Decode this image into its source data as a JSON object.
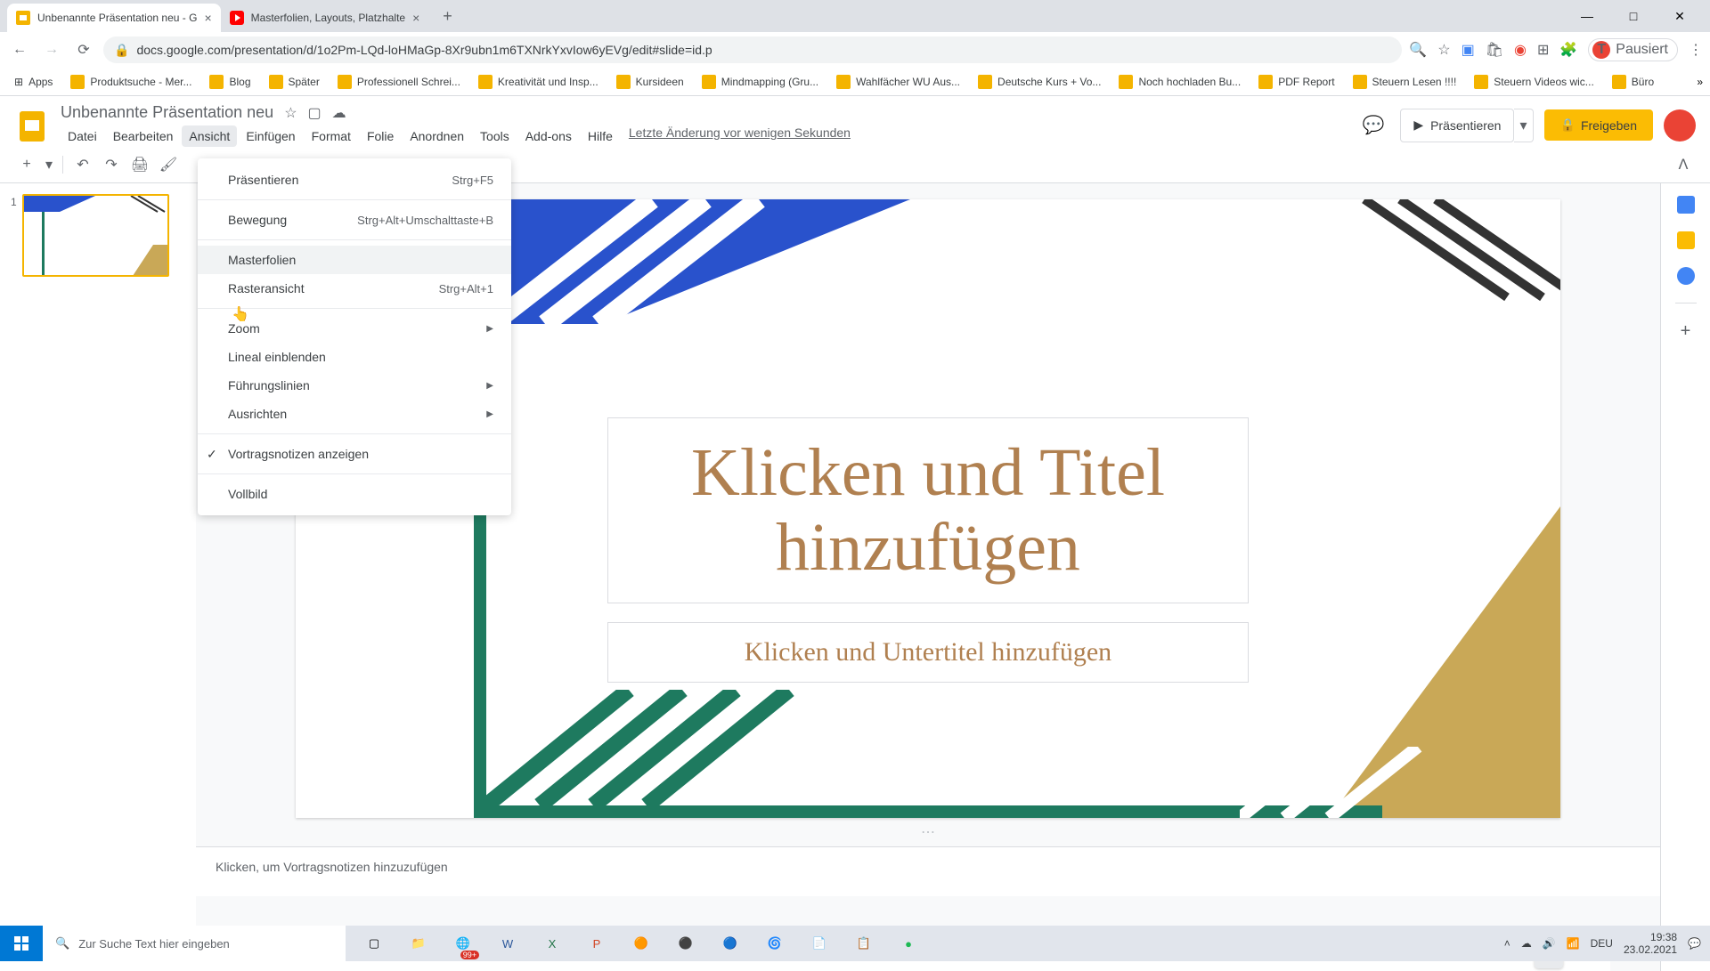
{
  "browser": {
    "tabs": [
      {
        "title": "Unbenannte Präsentation neu - G",
        "favicon": "slides"
      },
      {
        "title": "Masterfolien, Layouts, Platzhalte",
        "favicon": "youtube"
      }
    ],
    "url": "docs.google.com/presentation/d/1o2Pm-LQd-loHMaGp-8Xr9ubn1m6TXNrkYxvIow6yEVg/edit#slide=id.p",
    "avatar_label": "Pausiert"
  },
  "bookmarks": [
    "Apps",
    "Produktsuche - Mer...",
    "Blog",
    "Später",
    "Professionell Schrei...",
    "Kreativität und Insp...",
    "Kursideen",
    "Mindmapping  (Gru...",
    "Wahlfächer WU Aus...",
    "Deutsche Kurs + Vo...",
    "Noch hochladen Bu...",
    "PDF Report",
    "Steuern Lesen !!!!",
    "Steuern Videos wic...",
    "Büro"
  ],
  "app": {
    "doc_title": "Unbenannte Präsentation neu",
    "menus": [
      "Datei",
      "Bearbeiten",
      "Ansicht",
      "Einfügen",
      "Format",
      "Folie",
      "Anordnen",
      "Tools",
      "Add-ons",
      "Hilfe"
    ],
    "active_menu_index": 2,
    "last_edit": "Letzte Änderung vor wenigen Sekunden",
    "present": "Präsentieren",
    "share": "Freigeben"
  },
  "dropdown": {
    "items": [
      {
        "label": "Präsentieren",
        "shortcut": "Strg+F5"
      },
      {
        "sep": true
      },
      {
        "label": "Bewegung",
        "shortcut": "Strg+Alt+Umschalttaste+B",
        "bold": true
      },
      {
        "sep": true
      },
      {
        "label": "Masterfolien",
        "hover": true
      },
      {
        "label": "Rasteransicht",
        "shortcut": "Strg+Alt+1"
      },
      {
        "sep": true
      },
      {
        "label": "Zoom",
        "submenu": true
      },
      {
        "label": "Lineal einblenden"
      },
      {
        "label": "Führungslinien",
        "submenu": true
      },
      {
        "label": "Ausrichten",
        "submenu": true
      },
      {
        "sep": true
      },
      {
        "label": "Vortragsnotizen anzeigen",
        "checked": true
      },
      {
        "sep": true
      },
      {
        "label": "Vollbild"
      }
    ]
  },
  "slide": {
    "number": "1",
    "title_placeholder": "Klicken und Titel hinzufügen",
    "subtitle_placeholder": "Klicken und Untertitel hinzufügen",
    "notes_placeholder": "Klicken, um Vortragsnotizen hinzuzufügen"
  },
  "taskbar": {
    "search_placeholder": "Zur Suche Text hier eingeben",
    "lang": "DEU",
    "time": "19:38",
    "date": "23.02.2021",
    "badge": "99+"
  }
}
